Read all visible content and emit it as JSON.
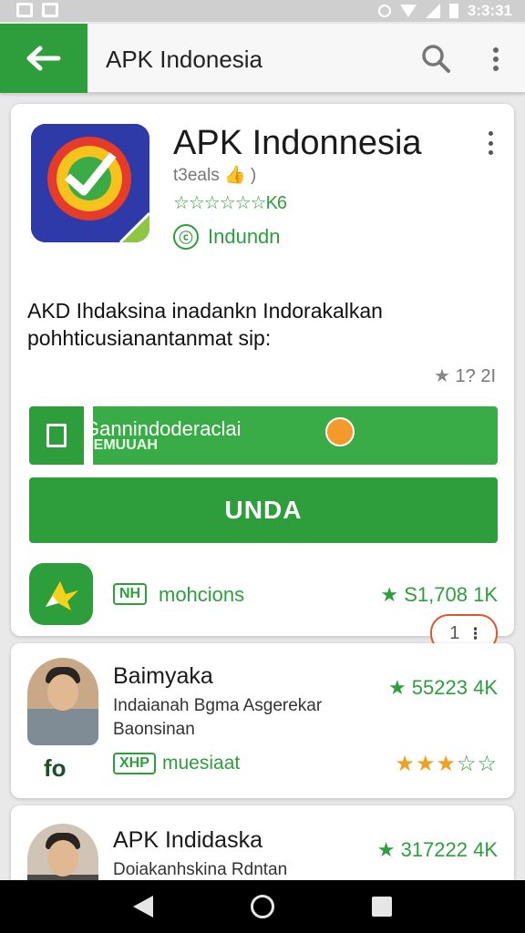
{
  "status_bar": {
    "time": "3:3:31"
  },
  "app_bar": {
    "title": "APK Indonesia"
  },
  "app": {
    "name": "APK Indonnesia",
    "developer": "t3eals 👍 )",
    "stars_text": "☆☆☆☆☆☆K6",
    "tag": "Indundn",
    "description": "AKD Ihdaksina inadankn Indorakalkan pohhticusianantanmat sip:",
    "rating_small": "1? 2I",
    "install_label": "Gannindoderaclai",
    "install_sub": "SEMUUAH",
    "primary_button": "UNDA",
    "row_badge": "NH",
    "row_text": "mohcions",
    "row_rating": "S1,708 1K",
    "pager_value": "1"
  },
  "list": [
    {
      "title": "Baimyaka",
      "desc_line1": "Indaianah Bgma Asgerekar",
      "desc_line2": "Baonsinan",
      "rating": "55223 4K",
      "badge": "XHP",
      "tag": "muesiaat",
      "logo": "fo",
      "stars_filled": 3,
      "stars_total": 5
    },
    {
      "title": "APK Indidaska",
      "desc_line1": "Doiakanhskina Rdntan",
      "rating": "317222 4K"
    }
  ],
  "colors": {
    "brand_green": "#2e9e3c",
    "accent_orange": "#e0552e",
    "icon_bg_blue": "#2d3aa7",
    "star_gold": "#f0a020"
  },
  "icons": [
    "back-arrow-icon",
    "search-icon",
    "more-vert-icon",
    "document-icon",
    "star-icon",
    "nav-back-icon",
    "nav-home-icon",
    "nav-recent-icon"
  ]
}
